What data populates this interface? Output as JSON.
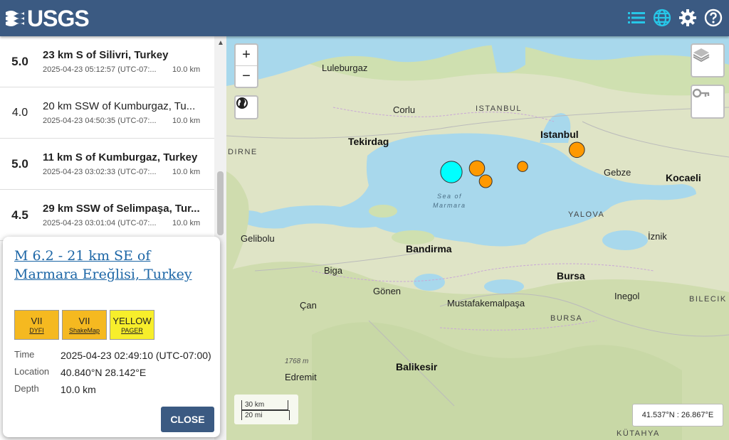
{
  "header": {
    "logo_text": "USGS",
    "icons": [
      "list-icon",
      "globe-icon",
      "gear-icon",
      "help-icon"
    ]
  },
  "earthquakes": [
    {
      "mag": "5.0",
      "place": "23 km S of Silivri, Turkey",
      "time": "2025-04-23 05:12:57 (UTC-07:...",
      "depth": "10.0 km"
    },
    {
      "mag": "4.0",
      "place": "20 km SSW of Kumburgaz, Tu...",
      "time": "2025-04-23 04:50:35 (UTC-07:...",
      "depth": "10.0 km"
    },
    {
      "mag": "5.0",
      "place": "11 km S of Kumburgaz, Turkey",
      "time": "2025-04-23 03:02:33 (UTC-07:...",
      "depth": "10.0 km"
    },
    {
      "mag": "4.5",
      "place": "29 km SSW of Selimpaşa, Tur...",
      "time": "2025-04-23 03:01:04 (UTC-07:...",
      "depth": "10.0 km"
    }
  ],
  "popup": {
    "title": "M 6.2 - 21 km SE of Marmara Ereğlisi, Turkey",
    "badges": [
      {
        "level": "VII",
        "source": "DYFI",
        "color": "#f5b920"
      },
      {
        "level": "VII",
        "source": "ShakeMap",
        "color": "#f5b920"
      },
      {
        "level": "YELLOW",
        "source": "PAGER",
        "color": "#f7ee2b"
      }
    ],
    "time_label": "Time",
    "time_value": "2025-04-23 02:49:10 (UTC-07:00)",
    "location_label": "Location",
    "location_value": "40.840°N 28.142°E",
    "depth_label": "Depth",
    "depth_value": "10.0 km",
    "close_label": "CLOSE"
  },
  "map": {
    "labels": {
      "luleburgaz": "Luleburgaz",
      "corlu": "Corlu",
      "istanbul_region": "ISTANBUL",
      "istanbul": "Istanbul",
      "tekirdag": "Tekirdag",
      "edirne": "DIRNE",
      "gebze": "Gebze",
      "kocaeli": "Kocaeli",
      "sea1": "Sea of",
      "sea2": "Marmara",
      "yalova": "YALOVA",
      "gelibolu": "Gelibolu",
      "iznik": "İznik",
      "bandirma": "Bandirma",
      "biga": "Biga",
      "bursa": "Bursa",
      "gonen": "Gönen",
      "inegol": "Inegol",
      "bilecik": "BILECIK",
      "can": "Çan",
      "mustafakemalpasa": "Mustafakemalpaşa",
      "bursa_region": "BURSA",
      "elev": "1768 m",
      "edremit": "Edremit",
      "balikesir": "Balikesir",
      "kutahya": "KÜTAHYA"
    },
    "scale_km": "30 km",
    "scale_mi": "20 mi",
    "coords": "41.537°N : 26.867°E",
    "events": [
      {
        "lat": 40.84,
        "lon": 28.142,
        "mag": 6.2,
        "color": "#00ffff"
      },
      {
        "lat": 40.86,
        "lon": 28.26,
        "mag": 5.0,
        "color": "#ff9900"
      },
      {
        "lat": 40.79,
        "lon": 28.3,
        "mag": 4.5,
        "color": "#ff9900"
      },
      {
        "lat": 40.87,
        "lon": 28.47,
        "mag": 4.0,
        "color": "#ff9900"
      },
      {
        "lat": 40.96,
        "lon": 28.72,
        "mag": 5.0,
        "color": "#ff9900"
      }
    ]
  }
}
